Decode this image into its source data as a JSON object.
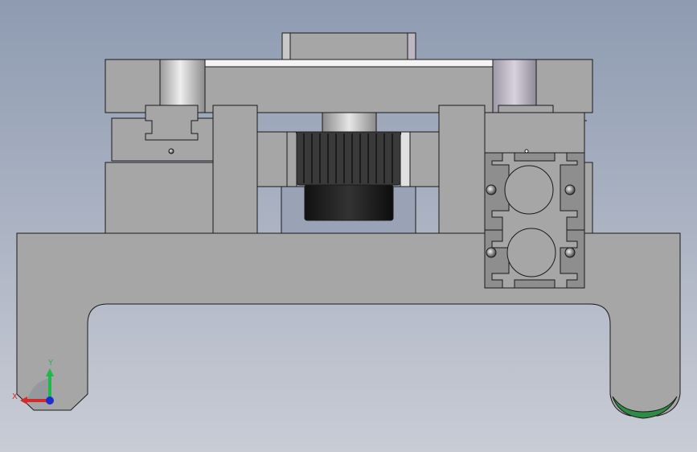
{
  "viewport": {
    "background_top": "#8e9bb1",
    "background_bottom": "#c9ccd5"
  },
  "colors": {
    "body": "#a6a6a6",
    "body_dark": "#989898",
    "edge": "#1a1a1a",
    "white_strip": "#f4f4f4",
    "shaft_light": "#dcdcdc",
    "shaft_purple": "#bdb7c3",
    "knurl": "#3a3a3a",
    "knurl_dark": "#1c1c1c",
    "green_cap": "#2e8b45",
    "axis_x": "#d42a2a",
    "axis_y": "#1fb84a",
    "axis_z": "#1b2fd0"
  },
  "triad": {
    "x_label": "X",
    "y_label": "Y",
    "x_icon": "x-axis-arrow",
    "y_icon": "y-axis-arrow",
    "z_icon": "z-axis-dot"
  }
}
